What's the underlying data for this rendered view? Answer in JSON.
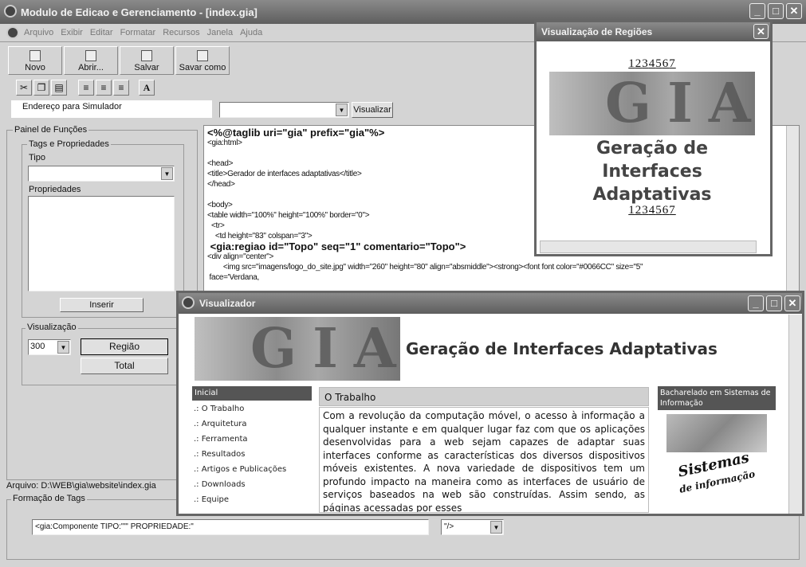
{
  "app": {
    "title": "Modulo de Edicao e Gerenciamento - [index.gia]",
    "menu": [
      "Arquivo",
      "Exibir",
      "Editar",
      "Formatar",
      "Recursos",
      "Janela",
      "Ajuda"
    ],
    "toolbar": [
      {
        "label": "Novo",
        "icon": "new-icon"
      },
      {
        "label": "Abrir...",
        "icon": "open-icon"
      },
      {
        "label": "Salvar",
        "icon": "save-icon"
      },
      {
        "label": "Savar como",
        "icon": "save-as-icon"
      }
    ],
    "format_tools": [
      "cut-icon",
      "copy-icon",
      "paste-icon",
      "align-left-icon",
      "align-center-icon",
      "align-right-icon",
      "font-icon"
    ],
    "font_glyph": "A",
    "address": {
      "label": "Endereço para Simulador",
      "value": "",
      "button": "Visualizar"
    },
    "panel": {
      "title": "Painel de Funções",
      "tags_group": "Tags e Propriedades",
      "tipo_label": "Tipo",
      "tipo_value": "",
      "props_label": "Propriedades",
      "insert_button": "Inserir",
      "viz_group": "Visualização",
      "viz_value": "300",
      "region_button": "Região",
      "total_button": "Total"
    },
    "editor": {
      "lines": [
        {
          "t": "<%@taglib uri=\"gia\" prefix=\"gia\"%>",
          "b": true
        },
        {
          "t": "<gia:html>"
        },
        {
          "t": ""
        },
        {
          "t": "<head>"
        },
        {
          "t": "<title>Gerador de interfaces adaptativas</title>"
        },
        {
          "t": "</head>"
        },
        {
          "t": ""
        },
        {
          "t": "<body>"
        },
        {
          "t": "<table width=\"100%\" height=\"100%\" border=\"0\">"
        },
        {
          "t": "  <tr>"
        },
        {
          "t": "    <td height=\"83\" colspan=\"3\">"
        },
        {
          "t": " <gia:regiao id=\"Topo\" seq=\"1\" comentario=\"Topo\">",
          "b": true
        },
        {
          "t": "<div align=\"center\">"
        },
        {
          "t": "        <img src=\"imagens/logo_do_site.jpg\" width=\"260\" height=\"80\" align=\"absmiddle\"><strong><font font color=\"#0066CC\" size=\"5\""
        },
        {
          "t": " face='Verdana,"
        }
      ]
    },
    "status": {
      "file": "Arquivo: D:\\WEB\\gia\\website\\index.gia"
    },
    "tags_form": {
      "title": "Formação de Tags",
      "value": "<gia:Componente  TIPO:\"\"' PROPRIEDADE:\"",
      "suffix": "\"/>"
    }
  },
  "regions_window": {
    "title": "Visualização de Regiões",
    "pages": [
      "1",
      "2",
      "3",
      "4",
      "5",
      "6",
      "7"
    ],
    "logo": "GIA",
    "heading": [
      "Geração de",
      "Interfaces",
      "Adaptativas"
    ]
  },
  "viewer": {
    "title": "Visualizador",
    "logo": "GIA",
    "heading": "Geração de Interfaces Adaptativas",
    "nav_header": "Inicial",
    "nav": [
      ".: O Trabalho",
      ".: Arquitetura",
      ".: Ferramenta",
      ".: Resultados",
      ".: Artigos e Publicações",
      ".: Downloads",
      ".: Equipe"
    ],
    "section_title": "O Trabalho",
    "body": "Com a revolução da computação móvel, o acesso à informação a qualquer instante e em qualquer lugar faz com que os aplicações desenvolvidas para a web sejam capazes de adaptar suas interfaces conforme as características dos diversos dispositivos móveis existentes. A nova variedade de dispositivos tem um profundo impacto na maneira como as interfaces de usuário de serviços baseados na web são construídas. Assim sendo, as páginas acessadas por esses",
    "side_header": "Bacharelado em Sistemas de Informação",
    "side_logo": "Sistemas de informação"
  }
}
